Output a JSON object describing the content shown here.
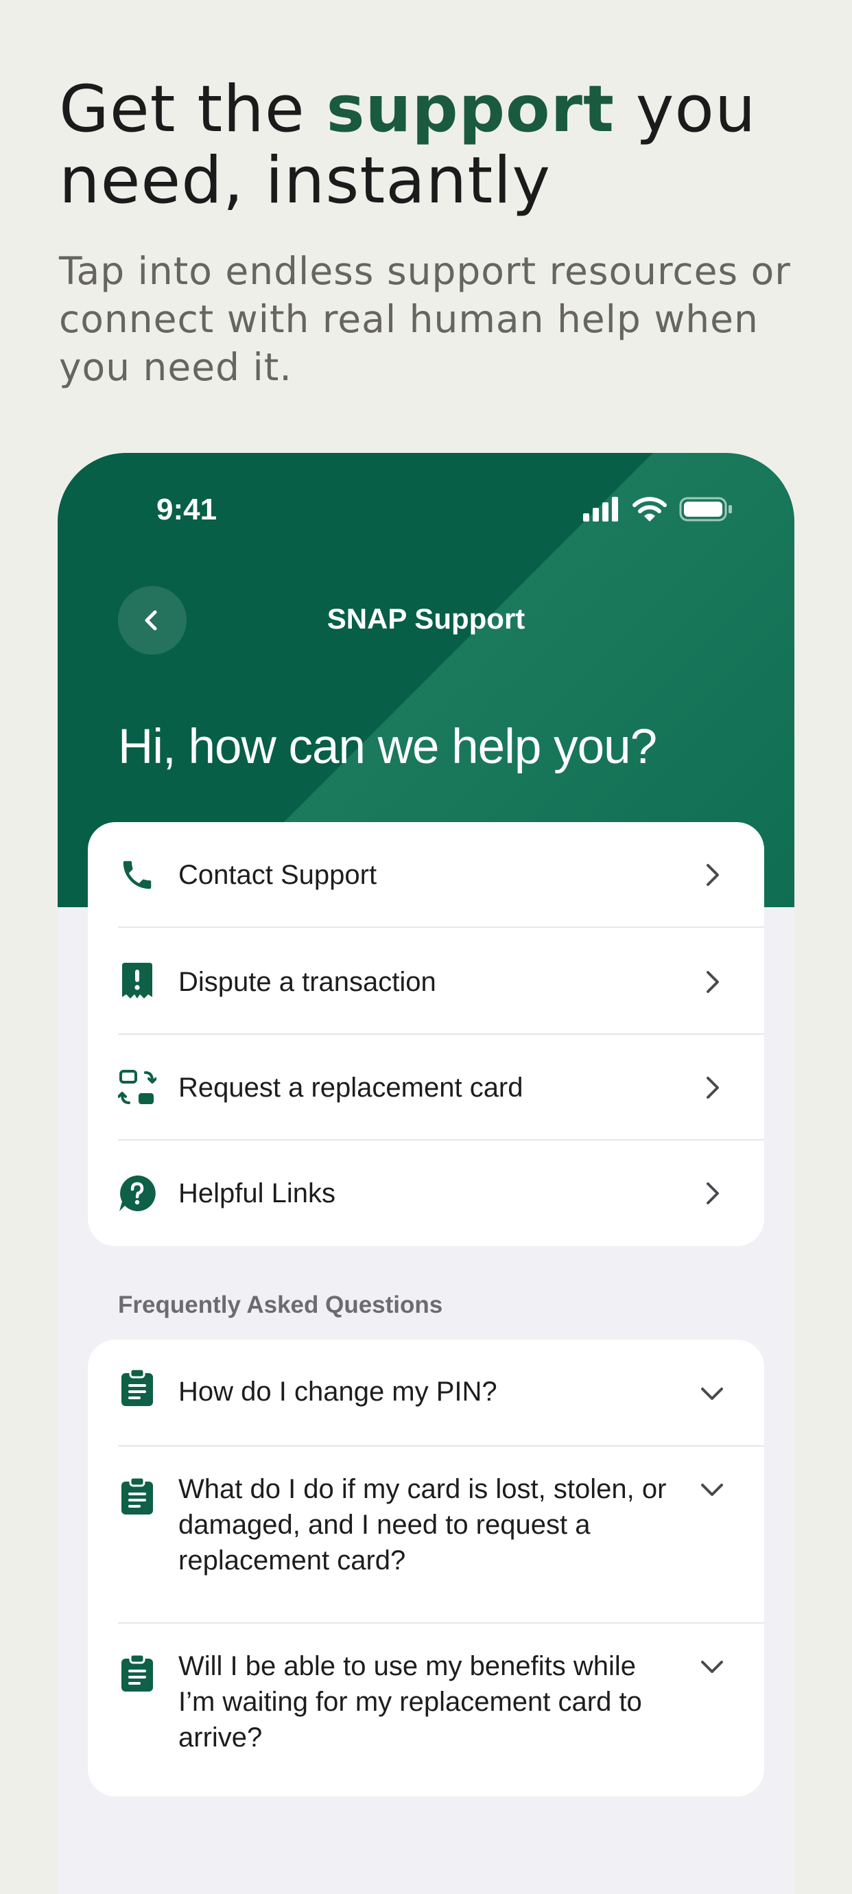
{
  "hero": {
    "title_before": "Get the ",
    "title_accent": "support",
    "title_after": " you need, instantly",
    "subtitle": "Tap into endless support resources or connect with real human help when you need it."
  },
  "status_bar": {
    "time": "9:41"
  },
  "nav": {
    "title": "SNAP Support"
  },
  "greeting": "Hi, how can we help you?",
  "menu": {
    "items": [
      {
        "label": "Contact Support",
        "icon": "phone-icon"
      },
      {
        "label": "Dispute a transaction",
        "icon": "receipt-alert-icon"
      },
      {
        "label": "Request a replacement card",
        "icon": "card-swap-icon"
      },
      {
        "label": "Helpful Links",
        "icon": "question-bubble-icon"
      }
    ]
  },
  "faq": {
    "heading": "Frequently Asked Questions",
    "items": [
      {
        "question": "How do I change my PIN?",
        "icon": "clipboard-icon"
      },
      {
        "question": "What do I do if my card is lost, stolen, or damaged, and I need to request a replacement card?",
        "icon": "clipboard-icon"
      },
      {
        "question": "Will I be able to use my benefits while I’m waiting for my replacement card to arrive?",
        "icon": "clipboard-icon"
      }
    ]
  },
  "colors": {
    "brand_green": "#065f46",
    "accent_text": "#1a5a3e",
    "icon_green": "#0e6046",
    "page_bg": "#efefe9"
  }
}
